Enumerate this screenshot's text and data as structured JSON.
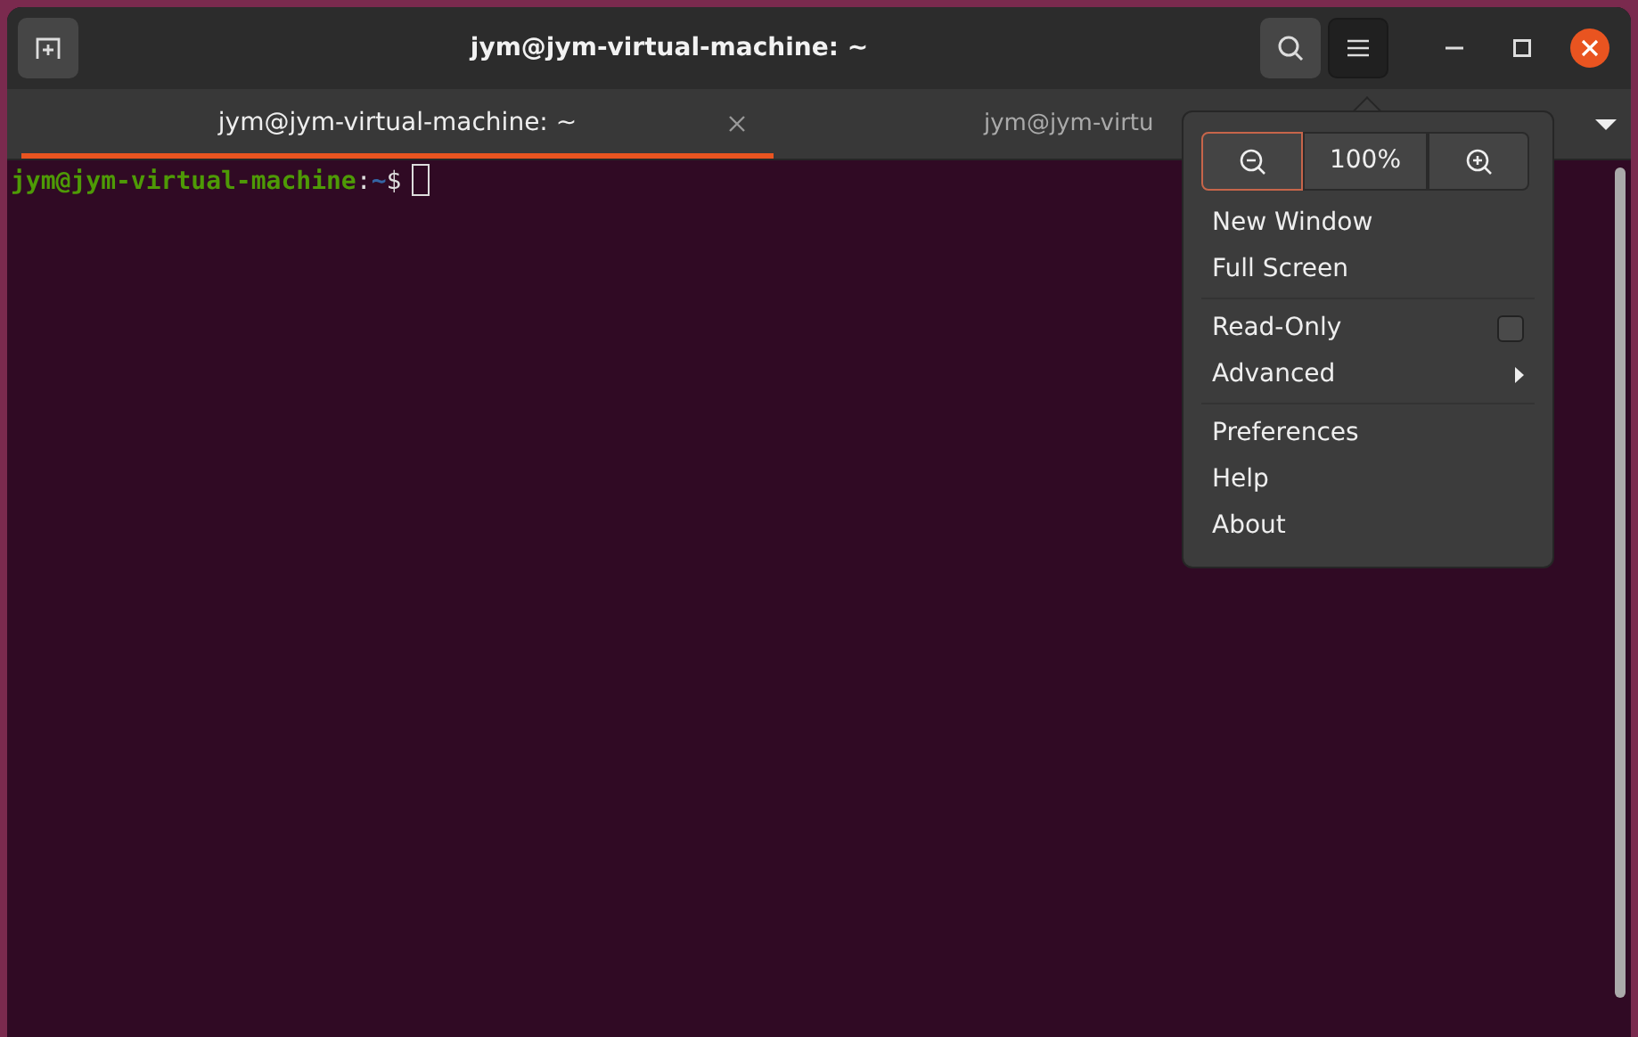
{
  "window": {
    "title": "jym@jym-virtual-machine: ~"
  },
  "tabs": [
    {
      "label": "jym@jym-virtual-machine: ~",
      "selected": true
    },
    {
      "label": "jym@jym-virtu",
      "selected": false
    }
  ],
  "terminal": {
    "user_host": "jym@jym-virtual-machine",
    "separator": ":",
    "path": "~",
    "prompt": "$"
  },
  "menu": {
    "zoom": {
      "level_text": "100%"
    },
    "sections": [
      [
        {
          "kind": "item",
          "label": "New Window"
        },
        {
          "kind": "item",
          "label": "Full Screen"
        }
      ],
      [
        {
          "kind": "check",
          "label": "Read-Only",
          "checked": false
        },
        {
          "kind": "submenu",
          "label": "Advanced"
        }
      ],
      [
        {
          "kind": "item",
          "label": "Preferences"
        },
        {
          "kind": "item",
          "label": "Help"
        },
        {
          "kind": "item",
          "label": "About"
        }
      ]
    ]
  }
}
